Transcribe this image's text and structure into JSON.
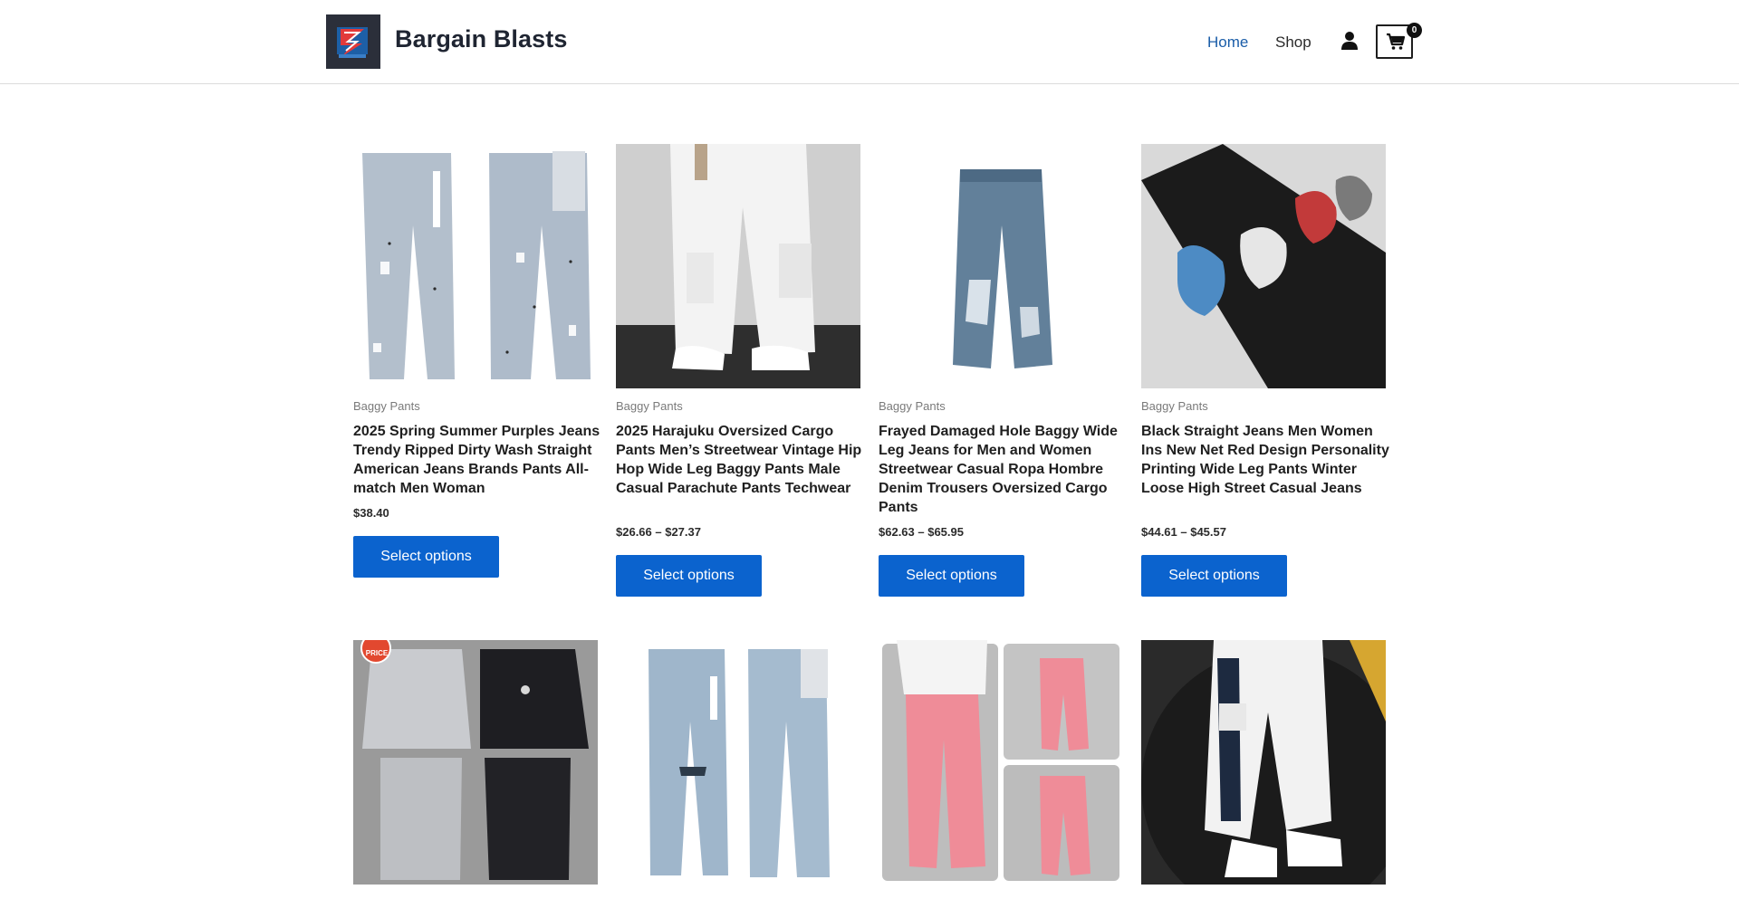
{
  "site": {
    "title": "Bargain Blasts"
  },
  "nav": {
    "home": "Home",
    "shop": "Shop"
  },
  "cart": {
    "count": "0"
  },
  "products": [
    {
      "category": "Baggy Pants",
      "title": "2025 Spring Summer Purples Jeans Trendy Ripped Dirty Wash Straight American Jeans Brands Pants All-match Men Woman",
      "price": "$38.40",
      "button": "Select options"
    },
    {
      "category": "Baggy Pants",
      "title": "2025 Harajuku Oversized Cargo Pants Men’s Streetwear Vintage Hip Hop Wide Leg Baggy Pants Male Casual Parachute Pants Techwear",
      "price": "$26.66 – $27.37",
      "button": "Select options"
    },
    {
      "category": "Baggy Pants",
      "title": "Frayed Damaged Hole Baggy Wide Leg Jeans for Men and Women Streetwear Casual Ropa Hombre Denim Trousers Oversized Cargo Pants",
      "price": "$62.63 – $65.95",
      "button": "Select options"
    },
    {
      "category": "Baggy Pants",
      "title": "Black Straight Jeans Men Women Ins New Net Red Design Personality Printing Wide Leg Pants Winter Loose High Street Casual Jeans",
      "price": "$44.61 – $45.57",
      "button": "Select options"
    }
  ],
  "badge": {
    "text": "PRICE"
  },
  "colors": {
    "accent": "#0b63ce",
    "nav_active": "#1a5da8",
    "title": "#1f2532"
  },
  "icons": [
    "account-icon",
    "cart-icon"
  ]
}
